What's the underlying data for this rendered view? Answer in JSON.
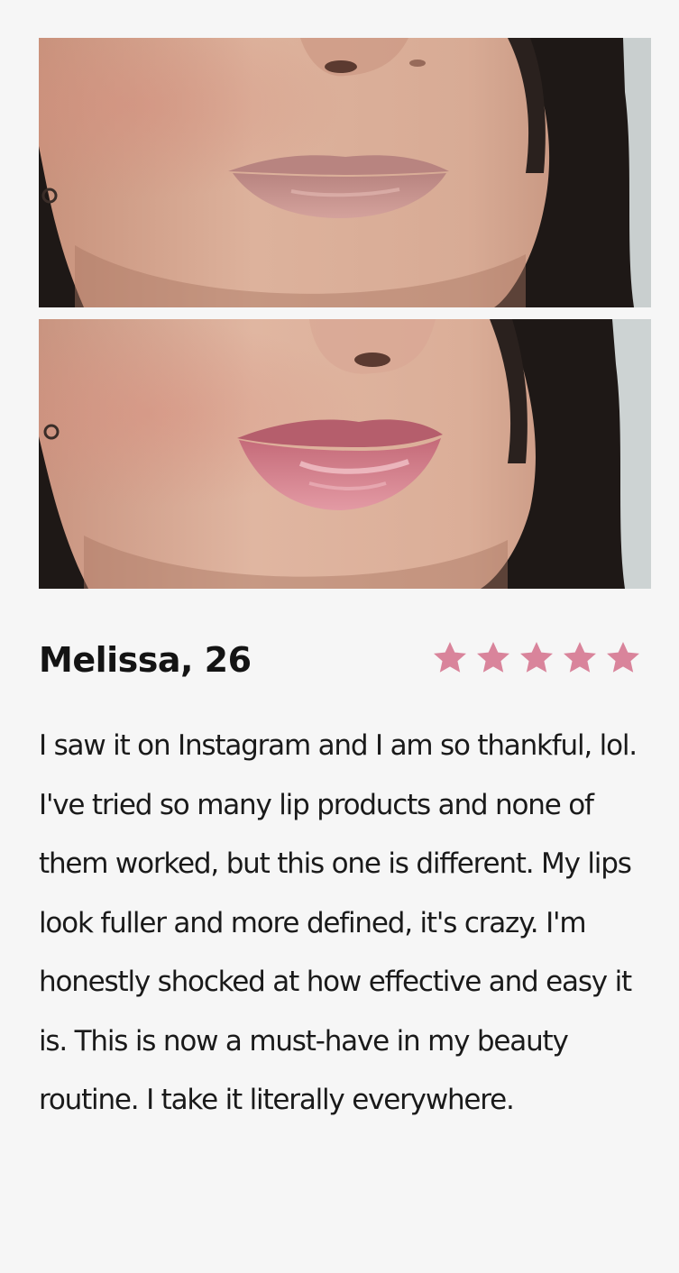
{
  "review": {
    "reviewer": "Melissa, 26",
    "rating": 5,
    "rating_max": 5,
    "star_color": "#d9849b",
    "text": "I saw it on Instagram and I am so thankful, lol. I've tried so many lip products and none of them worked, but this one is different. My lips look fuller and more defined, it's crazy. I'm honestly shocked at how effective and easy it is. This is now a must-have in my beauty routine. I take it literally everywhere."
  },
  "icons": {
    "star": "star-icon"
  }
}
